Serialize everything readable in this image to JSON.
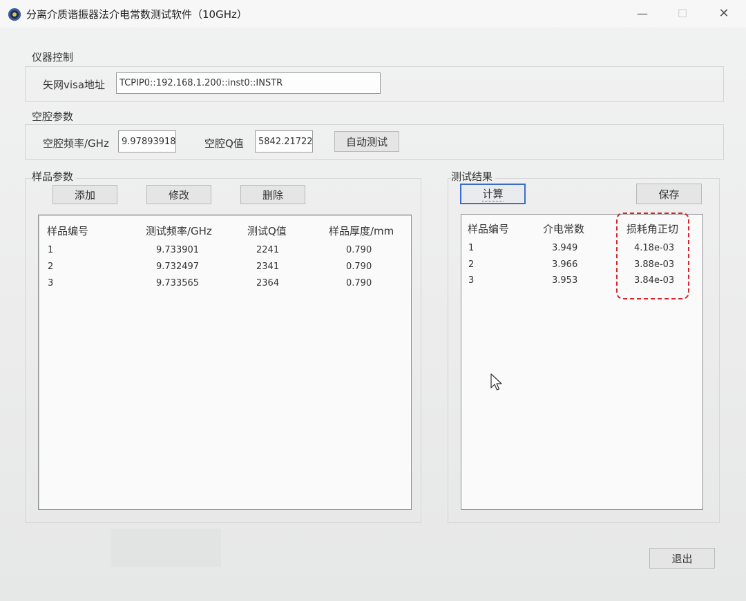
{
  "window": {
    "title": "分离介质谐振器法介电常数测试软件（10GHz）",
    "minimize": "—",
    "maximize": "☐",
    "close": "✕"
  },
  "instrument": {
    "group_label": "仪器控制",
    "visa_label": "矢网visa地址",
    "visa_value": "TCPIP0::192.168.1.200::inst0::INSTR"
  },
  "cavity": {
    "group_label": "空腔参数",
    "freq_label": "空腔频率/GHz",
    "freq_value": "9.97893918",
    "q_label": "空腔Q值",
    "q_value": "5842.21722",
    "auto_test_button": "自动测试"
  },
  "sample": {
    "group_label": "样品参数",
    "add_button": "添加",
    "edit_button": "修改",
    "delete_button": "删除",
    "columns": [
      "样品编号",
      "测试频率/GHz",
      "测试Q值",
      "样品厚度/mm"
    ],
    "rows": [
      [
        "1",
        "9.733901",
        "2241",
        "0.790"
      ],
      [
        "2",
        "9.732497",
        "2341",
        "0.790"
      ],
      [
        "3",
        "9.733565",
        "2364",
        "0.790"
      ]
    ]
  },
  "results": {
    "group_label": "测试结果",
    "calc_button": "计算",
    "save_button": "保存",
    "columns": [
      "样品编号",
      "介电常数",
      "损耗角正切"
    ],
    "rows": [
      [
        "1",
        "3.949",
        "4.18e-03"
      ],
      [
        "2",
        "3.966",
        "3.88e-03"
      ],
      [
        "3",
        "3.953",
        "3.84e-03"
      ]
    ]
  },
  "footer": {
    "exit_button": "退出"
  },
  "colors": {
    "highlight": "#d8232a",
    "default_button_border": "#3b6cc8"
  }
}
